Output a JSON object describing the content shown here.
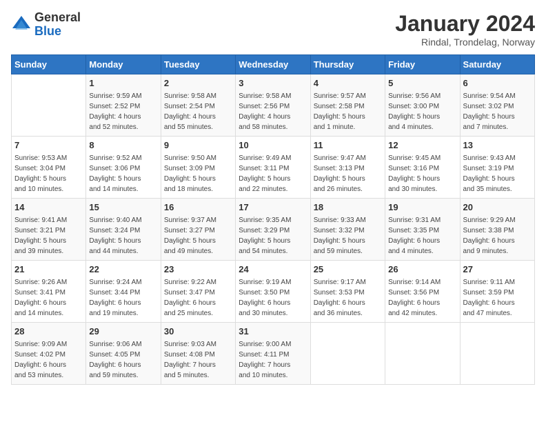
{
  "header": {
    "logo_general": "General",
    "logo_blue": "Blue",
    "month_title": "January 2024",
    "location": "Rindal, Trondelag, Norway"
  },
  "weekdays": [
    "Sunday",
    "Monday",
    "Tuesday",
    "Wednesday",
    "Thursday",
    "Friday",
    "Saturday"
  ],
  "weeks": [
    [
      {
        "day": "",
        "info": ""
      },
      {
        "day": "1",
        "info": "Sunrise: 9:59 AM\nSunset: 2:52 PM\nDaylight: 4 hours\nand 52 minutes."
      },
      {
        "day": "2",
        "info": "Sunrise: 9:58 AM\nSunset: 2:54 PM\nDaylight: 4 hours\nand 55 minutes."
      },
      {
        "day": "3",
        "info": "Sunrise: 9:58 AM\nSunset: 2:56 PM\nDaylight: 4 hours\nand 58 minutes."
      },
      {
        "day": "4",
        "info": "Sunrise: 9:57 AM\nSunset: 2:58 PM\nDaylight: 5 hours\nand 1 minute."
      },
      {
        "day": "5",
        "info": "Sunrise: 9:56 AM\nSunset: 3:00 PM\nDaylight: 5 hours\nand 4 minutes."
      },
      {
        "day": "6",
        "info": "Sunrise: 9:54 AM\nSunset: 3:02 PM\nDaylight: 5 hours\nand 7 minutes."
      }
    ],
    [
      {
        "day": "7",
        "info": "Sunrise: 9:53 AM\nSunset: 3:04 PM\nDaylight: 5 hours\nand 10 minutes."
      },
      {
        "day": "8",
        "info": "Sunrise: 9:52 AM\nSunset: 3:06 PM\nDaylight: 5 hours\nand 14 minutes."
      },
      {
        "day": "9",
        "info": "Sunrise: 9:50 AM\nSunset: 3:09 PM\nDaylight: 5 hours\nand 18 minutes."
      },
      {
        "day": "10",
        "info": "Sunrise: 9:49 AM\nSunset: 3:11 PM\nDaylight: 5 hours\nand 22 minutes."
      },
      {
        "day": "11",
        "info": "Sunrise: 9:47 AM\nSunset: 3:13 PM\nDaylight: 5 hours\nand 26 minutes."
      },
      {
        "day": "12",
        "info": "Sunrise: 9:45 AM\nSunset: 3:16 PM\nDaylight: 5 hours\nand 30 minutes."
      },
      {
        "day": "13",
        "info": "Sunrise: 9:43 AM\nSunset: 3:19 PM\nDaylight: 5 hours\nand 35 minutes."
      }
    ],
    [
      {
        "day": "14",
        "info": "Sunrise: 9:41 AM\nSunset: 3:21 PM\nDaylight: 5 hours\nand 39 minutes."
      },
      {
        "day": "15",
        "info": "Sunrise: 9:40 AM\nSunset: 3:24 PM\nDaylight: 5 hours\nand 44 minutes."
      },
      {
        "day": "16",
        "info": "Sunrise: 9:37 AM\nSunset: 3:27 PM\nDaylight: 5 hours\nand 49 minutes."
      },
      {
        "day": "17",
        "info": "Sunrise: 9:35 AM\nSunset: 3:29 PM\nDaylight: 5 hours\nand 54 minutes."
      },
      {
        "day": "18",
        "info": "Sunrise: 9:33 AM\nSunset: 3:32 PM\nDaylight: 5 hours\nand 59 minutes."
      },
      {
        "day": "19",
        "info": "Sunrise: 9:31 AM\nSunset: 3:35 PM\nDaylight: 6 hours\nand 4 minutes."
      },
      {
        "day": "20",
        "info": "Sunrise: 9:29 AM\nSunset: 3:38 PM\nDaylight: 6 hours\nand 9 minutes."
      }
    ],
    [
      {
        "day": "21",
        "info": "Sunrise: 9:26 AM\nSunset: 3:41 PM\nDaylight: 6 hours\nand 14 minutes."
      },
      {
        "day": "22",
        "info": "Sunrise: 9:24 AM\nSunset: 3:44 PM\nDaylight: 6 hours\nand 19 minutes."
      },
      {
        "day": "23",
        "info": "Sunrise: 9:22 AM\nSunset: 3:47 PM\nDaylight: 6 hours\nand 25 minutes."
      },
      {
        "day": "24",
        "info": "Sunrise: 9:19 AM\nSunset: 3:50 PM\nDaylight: 6 hours\nand 30 minutes."
      },
      {
        "day": "25",
        "info": "Sunrise: 9:17 AM\nSunset: 3:53 PM\nDaylight: 6 hours\nand 36 minutes."
      },
      {
        "day": "26",
        "info": "Sunrise: 9:14 AM\nSunset: 3:56 PM\nDaylight: 6 hours\nand 42 minutes."
      },
      {
        "day": "27",
        "info": "Sunrise: 9:11 AM\nSunset: 3:59 PM\nDaylight: 6 hours\nand 47 minutes."
      }
    ],
    [
      {
        "day": "28",
        "info": "Sunrise: 9:09 AM\nSunset: 4:02 PM\nDaylight: 6 hours\nand 53 minutes."
      },
      {
        "day": "29",
        "info": "Sunrise: 9:06 AM\nSunset: 4:05 PM\nDaylight: 6 hours\nand 59 minutes."
      },
      {
        "day": "30",
        "info": "Sunrise: 9:03 AM\nSunset: 4:08 PM\nDaylight: 7 hours\nand 5 minutes."
      },
      {
        "day": "31",
        "info": "Sunrise: 9:00 AM\nSunset: 4:11 PM\nDaylight: 7 hours\nand 10 minutes."
      },
      {
        "day": "",
        "info": ""
      },
      {
        "day": "",
        "info": ""
      },
      {
        "day": "",
        "info": ""
      }
    ]
  ]
}
